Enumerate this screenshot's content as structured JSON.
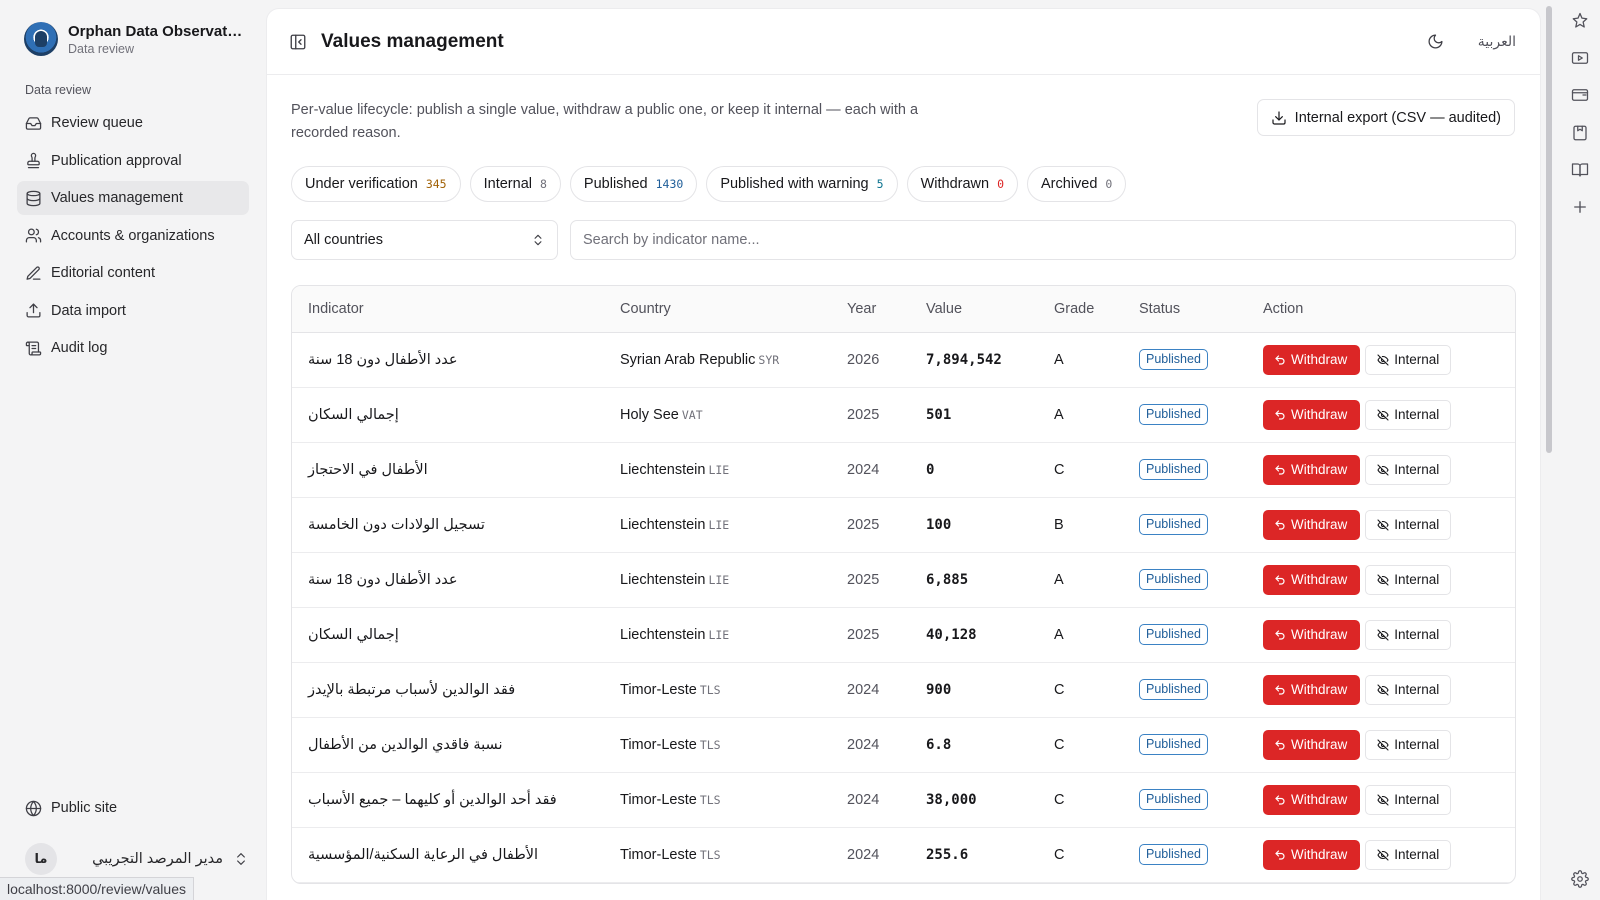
{
  "sidebar": {
    "brand_name": "Orphan Data Observatory",
    "brand_sub": "Data review",
    "group_label": "Data review",
    "items": [
      {
        "label": "Review queue"
      },
      {
        "label": "Publication approval"
      },
      {
        "label": "Values management"
      },
      {
        "label": "Accounts & organizations"
      },
      {
        "label": "Editorial content"
      },
      {
        "label": "Data import"
      },
      {
        "label": "Audit log"
      }
    ],
    "public_site": "Public site",
    "user_initials": "ما",
    "user_name": "مدير المرصد التجريبي",
    "status_url": "localhost:8000/review/values"
  },
  "header": {
    "title": "Values management",
    "lang_label": "العربية"
  },
  "main": {
    "description": "Per-value lifecycle: publish a single value, withdraw a public one, or keep it internal — each with a recorded reason.",
    "export_label": "Internal export (CSV — audited)",
    "filters": [
      {
        "label": "Under verification",
        "count": "345",
        "color": "#a16207"
      },
      {
        "label": "Internal",
        "count": "8",
        "color": "#71717a"
      },
      {
        "label": "Published",
        "count": "1430",
        "color": "#1f5e99"
      },
      {
        "label": "Published with warning",
        "count": "5",
        "color": "#0e7490"
      },
      {
        "label": "Withdrawn",
        "count": "0",
        "color": "#dc2626"
      },
      {
        "label": "Archived",
        "count": "0",
        "color": "#71717a"
      }
    ],
    "country_select": "All countries",
    "search_placeholder": "Search by indicator name..."
  },
  "table": {
    "columns": [
      "Indicator",
      "Country",
      "Year",
      "Value",
      "Grade",
      "Status",
      "Action"
    ],
    "withdraw_label": "Withdraw",
    "internal_label": "Internal",
    "rows": [
      {
        "indicator": "عدد الأطفال دون 18 سنة",
        "country": "Syrian Arab Republic",
        "iso": "SYR",
        "year": "2026",
        "value": "7,894,542",
        "grade": "A",
        "status": "Published"
      },
      {
        "indicator": "إجمالي السكان",
        "country": "Holy See",
        "iso": "VAT",
        "year": "2025",
        "value": "501",
        "grade": "A",
        "status": "Published"
      },
      {
        "indicator": "الأطفال في الاحتجاز",
        "country": "Liechtenstein",
        "iso": "LIE",
        "year": "2024",
        "value": "0",
        "grade": "C",
        "status": "Published"
      },
      {
        "indicator": "تسجيل الولادات دون الخامسة",
        "country": "Liechtenstein",
        "iso": "LIE",
        "year": "2025",
        "value": "100",
        "grade": "B",
        "status": "Published"
      },
      {
        "indicator": "عدد الأطفال دون 18 سنة",
        "country": "Liechtenstein",
        "iso": "LIE",
        "year": "2025",
        "value": "6,885",
        "grade": "A",
        "status": "Published"
      },
      {
        "indicator": "إجمالي السكان",
        "country": "Liechtenstein",
        "iso": "LIE",
        "year": "2025",
        "value": "40,128",
        "grade": "A",
        "status": "Published"
      },
      {
        "indicator": "فقد الوالدين لأسباب مرتبطة بالإيدز",
        "country": "Timor-Leste",
        "iso": "TLS",
        "year": "2024",
        "value": "900",
        "grade": "C",
        "status": "Published"
      },
      {
        "indicator": "نسبة فاقدي الوالدين من الأطفال",
        "country": "Timor-Leste",
        "iso": "TLS",
        "year": "2024",
        "value": "6.8",
        "grade": "C",
        "status": "Published"
      },
      {
        "indicator": "فقد أحد الوالدين أو كليهما – جميع الأسباب",
        "country": "Timor-Leste",
        "iso": "TLS",
        "year": "2024",
        "value": "38,000",
        "grade": "C",
        "status": "Published"
      },
      {
        "indicator": "الأطفال في الرعاية السكنية/المؤسسية",
        "country": "Timor-Leste",
        "iso": "TLS",
        "year": "2024",
        "value": "255.6",
        "grade": "C",
        "status": "Published"
      }
    ]
  },
  "colors": {
    "accent_red": "#dc2626",
    "published_blue": "#3b82c4"
  }
}
